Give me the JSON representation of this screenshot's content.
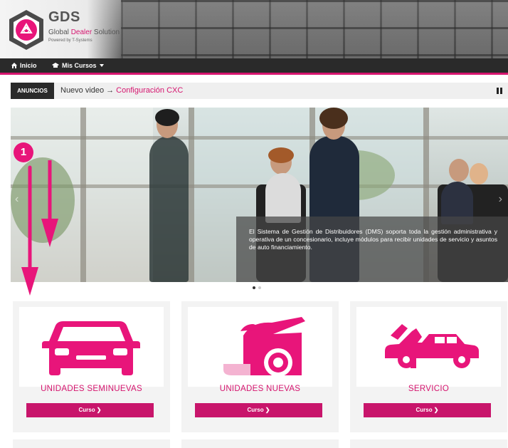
{
  "brand": {
    "logo_abbr": "GDS",
    "name_part1": "Global ",
    "name_highlight": "Dealer",
    "name_part2": " Solution",
    "powered_by": "Powered by T-Systems"
  },
  "nav": {
    "items": [
      {
        "label": "Inicio",
        "icon": "home-icon"
      },
      {
        "label": "Mis Cursos",
        "icon": "graduation-cap-icon"
      }
    ]
  },
  "announcement": {
    "label": "ANUNCIOS",
    "text": "Nuevo video",
    "arrow": "→",
    "link": "Configuración CXC"
  },
  "carousel": {
    "caption": "El Sistema de Gestión de Distribuidores (DMS) soporta toda la gestión administrativa y operativa de un concesionario, incluye módulos para recibir unidades de servicio y asuntos de auto financiamiento.",
    "prev": "‹",
    "next": "›",
    "slides": 2,
    "active_slide": 1
  },
  "annotation": {
    "number": "1"
  },
  "courses": [
    {
      "title": "UNIDADES SEMINUEVAS",
      "button": "Curso ❯",
      "icon": "car-icon"
    },
    {
      "title": "UNIDADES NUEVAS",
      "button": "Curso ❯",
      "icon": "new-car-icon"
    },
    {
      "title": "SERVICIO",
      "button": "Curso ❯",
      "icon": "car-service-icon"
    }
  ],
  "colors": {
    "accent": "#d6156f",
    "nav_bg": "#2a2a2a",
    "annotation": "#e8157a"
  }
}
